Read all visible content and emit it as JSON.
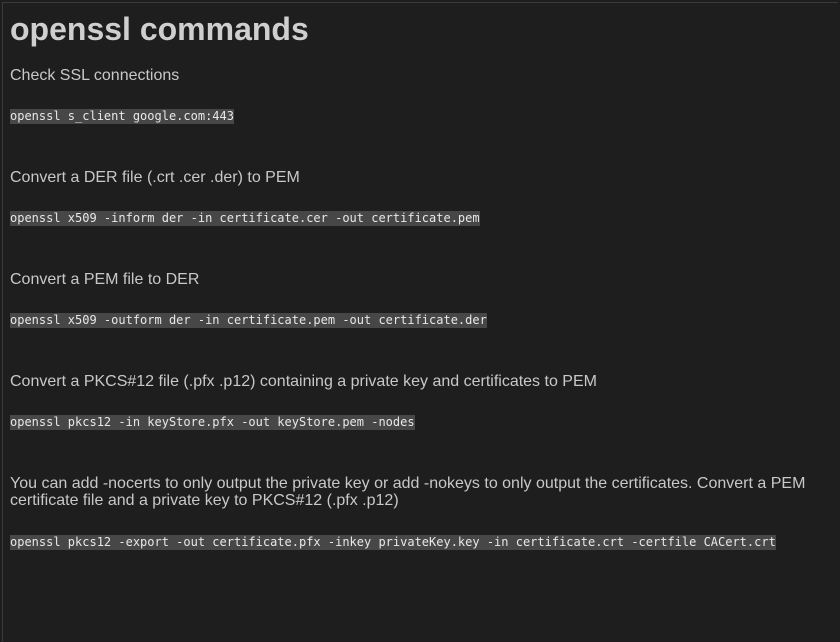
{
  "page": {
    "title": "openssl commands"
  },
  "sections": [
    {
      "description": "Check SSL connections",
      "command": "openssl s_client google.com:443"
    },
    {
      "description": "Convert a DER file (.crt .cer .der) to PEM",
      "command": "openssl x509 -inform der -in certificate.cer -out certificate.pem"
    },
    {
      "description": "Convert a PEM file to DER",
      "command": "openssl x509 -outform der -in certificate.pem -out certificate.der"
    },
    {
      "description": "Convert a PKCS#12 file (.pfx .p12) containing a private key and certificates to PEM",
      "command": "openssl pkcs12 -in keyStore.pfx -out keyStore.pem -nodes"
    },
    {
      "description": "You can add -nocerts to only output the private key or add -nokeys to only output the certificates. Convert a PEM certificate file and a private key to PKCS#12 (.pfx .p12)",
      "command": "openssl pkcs12 -export -out certificate.pfx -inkey privateKey.key -in certificate.crt -certfile CACert.crt"
    }
  ]
}
